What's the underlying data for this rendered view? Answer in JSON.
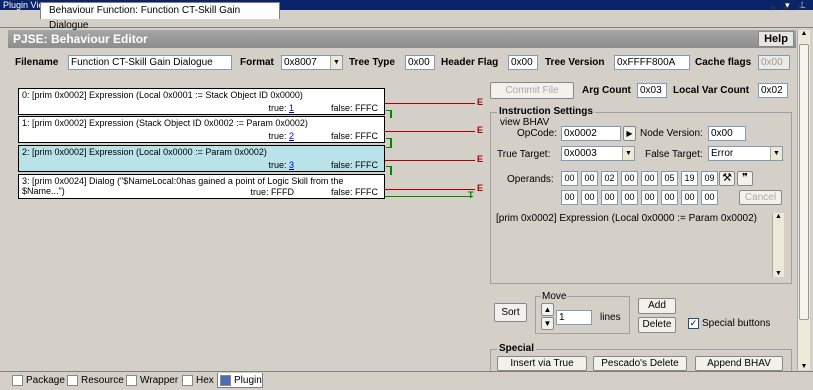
{
  "window": {
    "title": "Plugin View",
    "icons": "▾ ⊥"
  },
  "doc_tab": {
    "label": "Behaviour Function: Function CT-Skill Gain Dialogue",
    "arrows": "◂ ▸ ✕"
  },
  "editor": {
    "header": "PJSE: Behaviour Editor",
    "help_label": "Help"
  },
  "props": {
    "filename_label": "Filename",
    "filename": "Function CT-Skill Gain Dialogue",
    "format_label": "Format",
    "format": "0x8007",
    "tree_type_label": "Tree Type",
    "tree_type": "0x00",
    "header_flag_label": "Header Flag",
    "header_flag": "0x00",
    "tree_version_label": "Tree Version",
    "tree_version": "0xFFFF800A",
    "cache_flags_label": "Cache flags",
    "cache_flags": "0x00"
  },
  "instructions": [
    {
      "line1": "0: [prim 0x0002] Expression (Local 0x0001 := Stack Object ID 0x0000)",
      "true_label": "true:",
      "true_val": "1",
      "false_label": "false:",
      "false_val": "FFFC"
    },
    {
      "line1": "1: [prim 0x0002] Expression (Stack Object ID 0x0002 := Param 0x0002)",
      "true_label": "true:",
      "true_val": "2",
      "false_label": "false:",
      "false_val": "FFFC"
    },
    {
      "line1": "2: [prim 0x0002] Expression (Local 0x0000 := Param 0x0002)",
      "true_label": "true:",
      "true_val": "3",
      "false_label": "false:",
      "false_val": "FFFC"
    },
    {
      "line1": "3: [prim 0x0024] Dialog (\"$NameLocal:0has gained a point of Logic Skill from the",
      "line2": "$Name...\")",
      "true_label": "true:",
      "true_val": "FFFD",
      "false_label": "false:",
      "false_val": "FFFC"
    }
  ],
  "markers": {
    "e": "E",
    "t": "T"
  },
  "right": {
    "commit_label": "Commit File",
    "arg_count_label": "Arg Count",
    "arg_count": "0x03",
    "local_var_label": "Local Var Count",
    "local_var": "0x02",
    "instr_settings_title": "Instruction Settings",
    "view_bhav": "view BHAV",
    "opcode_label": "OpCode:",
    "opcode": "0x0002",
    "opcode_btn": "▶",
    "node_version_label": "Node Version:",
    "node_version": "0x00",
    "true_target_label": "True Target:",
    "true_target": "0x0003",
    "false_target_label": "False Target:",
    "false_target": "Error",
    "operands_label": "Operands:",
    "operands_row1": [
      "00",
      "00",
      "02",
      "00",
      "00",
      "05",
      "19",
      "09"
    ],
    "operands_row2": [
      "00",
      "00",
      "00",
      "00",
      "00",
      "00",
      "00",
      "00"
    ],
    "tool_icon": "⚒",
    "quote_icon": "❞",
    "cancel_label": "Cancel",
    "description": "[prim 0x0002] Expression (Local 0x0000 := Param 0x0002)",
    "sort_label": "Sort",
    "move_title": "Move",
    "move_value": "1",
    "lines_label": "lines",
    "add_label": "Add",
    "delete_label": "Delete",
    "special_buttons_label": "Special buttons",
    "special_title": "Special",
    "insert_via_true": "Insert via True",
    "pescado_delete": "Pescado's Delete",
    "append_bhav": "Append BHAV"
  },
  "bottom_tabs": [
    {
      "label": "Package"
    },
    {
      "label": "Resource"
    },
    {
      "label": "Wrapper"
    },
    {
      "label": "Hex"
    },
    {
      "label": "Plugin"
    }
  ]
}
